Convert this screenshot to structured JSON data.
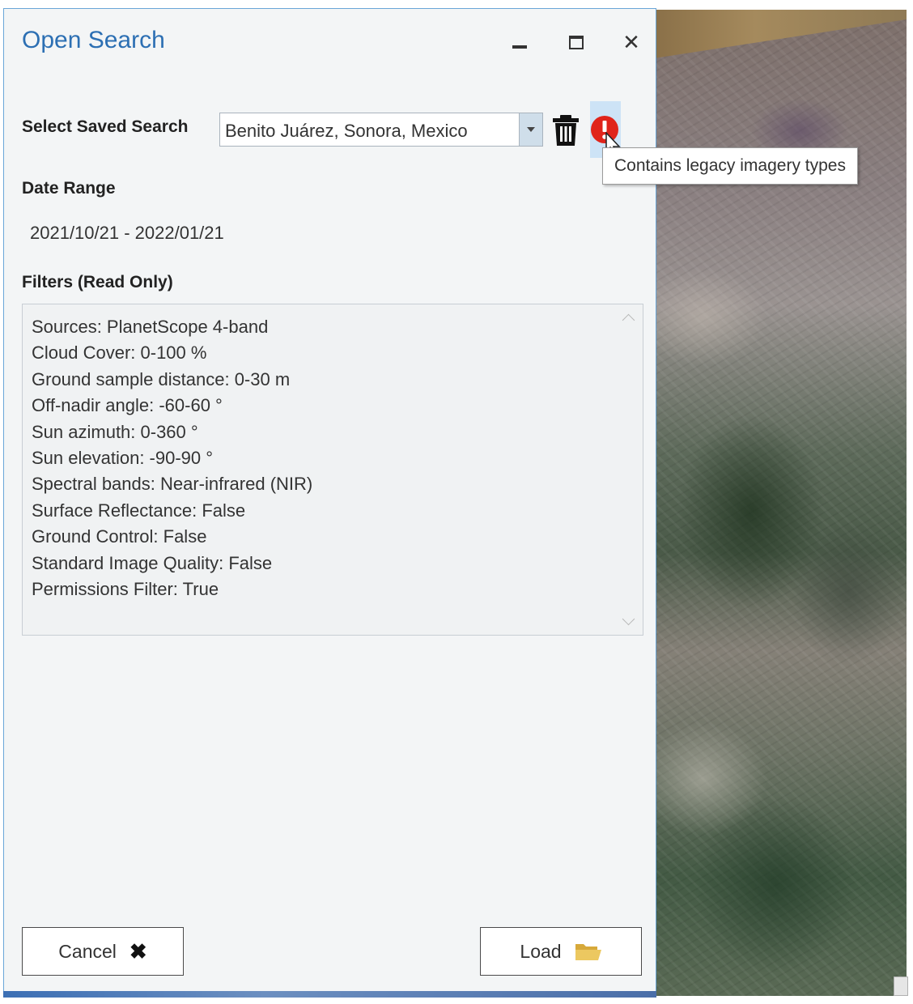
{
  "dialog": {
    "title": "Open Search",
    "window_controls": {
      "minimize_icon": "minimize-icon",
      "maximize_icon": "maximize-icon",
      "close_icon": "close-icon",
      "close_glyph": "✕"
    }
  },
  "saved_search": {
    "label": "Select Saved Search",
    "selected_value": "Benito Juárez, Sonora, Mexico",
    "delete_icon": "trash-icon",
    "warning_icon": "warning-icon",
    "warning_color": "#e0241b",
    "tooltip": "Contains legacy imagery types"
  },
  "date_range": {
    "label": "Date Range",
    "value": "2021/10/21 - 2022/01/21"
  },
  "filters": {
    "label": "Filters (Read Only)",
    "items": [
      "Sources: PlanetScope 4-band",
      "Cloud Cover: 0-100 %",
      "Ground sample distance: 0-30 m",
      "Off-nadir angle: -60-60 °",
      "Sun azimuth: 0-360 °",
      "Sun elevation: -90-90 °",
      "Spectral bands: Near-infrared (NIR)",
      "Surface Reflectance: False",
      "Ground Control: False",
      "Standard Image Quality: False",
      "Permissions Filter: True"
    ]
  },
  "buttons": {
    "cancel_label": "Cancel",
    "cancel_glyph": "✖",
    "load_label": "Load",
    "load_icon": "folder-open-icon",
    "load_icon_color": "#e8c45a"
  },
  "colors": {
    "title": "#2c6fb3",
    "dialog_border": "#6aa6d8",
    "dialog_bg": "#f3f5f6"
  }
}
